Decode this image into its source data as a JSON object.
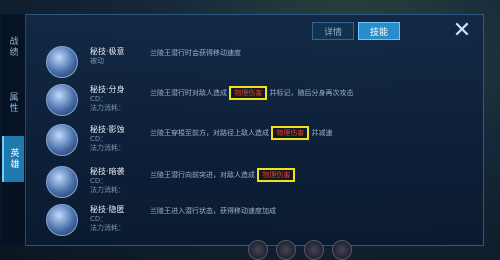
{
  "window": {
    "title": ""
  },
  "sidebar": {
    "tabs": [
      {
        "label": "战绩",
        "active": false
      },
      {
        "label": "属性",
        "active": false
      },
      {
        "label": "英雄",
        "active": true
      }
    ]
  },
  "header": {
    "subtitle": "",
    "tabs": [
      {
        "label": "详情",
        "active": false
      },
      {
        "label": "技能",
        "active": true
      }
    ],
    "close_icon": "close-x"
  },
  "skills": [
    {
      "name": "秘技·极意",
      "stats": [
        "被动"
      ],
      "desc_before": "兰陵王潜行时会获得移动速度",
      "highlight": "",
      "desc_after": ""
    },
    {
      "name": "秘技·分身",
      "stats": [
        "CD：",
        "法力消耗："
      ],
      "desc_before": "兰陵王潜行时对敌人造成",
      "highlight": "物理伤害",
      "desc_after": "并标记，随后分身再次攻击"
    },
    {
      "name": "秘技·影蚀",
      "stats": [
        "CD：",
        "法力消耗："
      ],
      "desc_before": "兰陵王穿梭至前方，对路径上敌人造成",
      "highlight": "物理伤害",
      "desc_after": "并减速"
    },
    {
      "name": "秘技·暗袭",
      "stats": [
        "CD：",
        "法力消耗："
      ],
      "desc_before": "兰陵王潜行向前突进，对敌人造成",
      "highlight": "物理伤害",
      "desc_after": ""
    },
    {
      "name": "秘技·隐匿",
      "stats": [
        "CD：",
        "法力消耗："
      ],
      "desc_before": "兰陵王进入潜行状态，获得移动速度加成",
      "highlight": "",
      "desc_after": ""
    }
  ],
  "colors": {
    "highlight_border": "#f0e020",
    "highlight_text": "#e04030",
    "active_tab": "#2a8cc8"
  }
}
